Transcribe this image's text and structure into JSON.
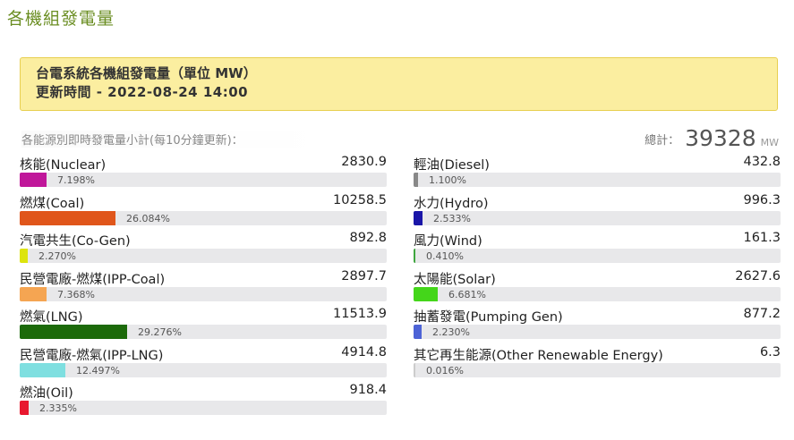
{
  "page_title": "各機組發電量",
  "notice": {
    "line1": "台電系統各機組發電量（單位 MW）",
    "line2": "更新時間 - 2022-08-24 14:00"
  },
  "subtitle": "各能源別即時發電量小計(每10分鐘更新)：",
  "total": {
    "label": "總計：",
    "value": "39328",
    "unit": "MW"
  },
  "left_column": [
    {
      "id": "nuclear",
      "label": "核能(Nuclear)",
      "value": "2830.9",
      "percent": "7.198%",
      "fraction": 0.07198,
      "color": "#c0179a"
    },
    {
      "id": "coal",
      "label": "燃煤(Coal)",
      "value": "10258.5",
      "percent": "26.084%",
      "fraction": 0.26084,
      "color": "#e0561b"
    },
    {
      "id": "cogen",
      "label": "汽電共生(Co-Gen)",
      "value": "892.8",
      "percent": "2.270%",
      "fraction": 0.0227,
      "color": "#dde40e"
    },
    {
      "id": "ipp-coal",
      "label": "民營電廠-燃煤(IPP-Coal)",
      "value": "2897.7",
      "percent": "7.368%",
      "fraction": 0.07368,
      "color": "#f5a552"
    },
    {
      "id": "lng",
      "label": "燃氣(LNG)",
      "value": "11513.9",
      "percent": "29.276%",
      "fraction": 0.29276,
      "color": "#1c6a0a"
    },
    {
      "id": "ipp-lng",
      "label": "民營電廠-燃氣(IPP-LNG)",
      "value": "4914.8",
      "percent": "12.497%",
      "fraction": 0.12497,
      "color": "#7fdfe0"
    },
    {
      "id": "oil",
      "label": "燃油(Oil)",
      "value": "918.4",
      "percent": "2.335%",
      "fraction": 0.02335,
      "color": "#e8182f"
    }
  ],
  "right_column": [
    {
      "id": "diesel",
      "label": "輕油(Diesel)",
      "value": "432.8",
      "percent": "1.100%",
      "fraction": 0.011,
      "color": "#888888"
    },
    {
      "id": "hydro",
      "label": "水力(Hydro)",
      "value": "996.3",
      "percent": "2.533%",
      "fraction": 0.02533,
      "color": "#1a16a8"
    },
    {
      "id": "wind",
      "label": "風力(Wind)",
      "value": "161.3",
      "percent": "0.410%",
      "fraction": 0.0041,
      "color": "#3fa63f"
    },
    {
      "id": "solar",
      "label": "太陽能(Solar)",
      "value": "2627.6",
      "percent": "6.681%",
      "fraction": 0.06681,
      "color": "#44d61a"
    },
    {
      "id": "pumping",
      "label": "抽蓄發電(Pumping Gen)",
      "value": "877.2",
      "percent": "2.230%",
      "fraction": 0.0223,
      "color": "#4d63d6"
    },
    {
      "id": "other-renewable",
      "label": "其它再生能源(Other Renewable Energy)",
      "value": "6.3",
      "percent": "0.016%",
      "fraction": 0.00016,
      "color": "#cccccc"
    }
  ]
}
